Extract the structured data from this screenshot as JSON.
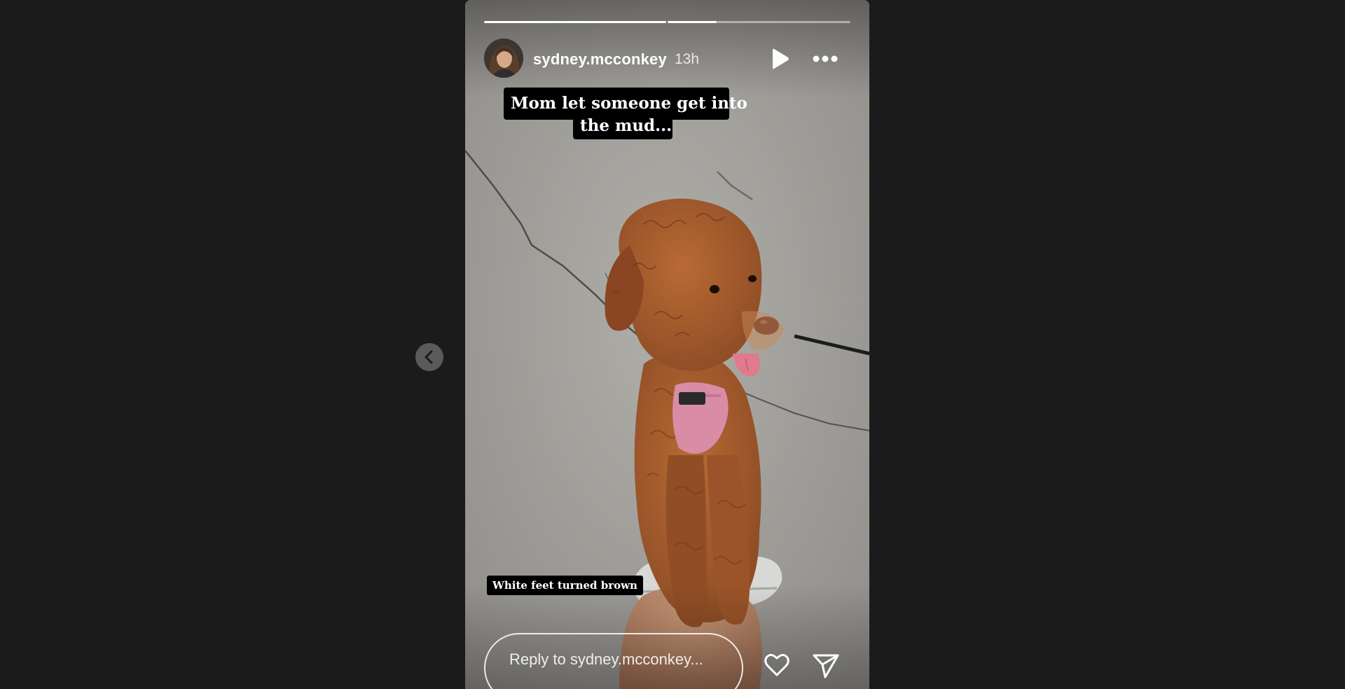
{
  "story": {
    "username": "sydney.mcconkey",
    "timestamp": "13h",
    "progress": [
      1.0,
      0.27
    ],
    "caption_lines": [
      "Mom let someone get into",
      "the mud..."
    ],
    "sticker_text": "White feet turned brown",
    "reply_placeholder": "Reply to sydney.mcconkey...",
    "icons": {
      "play": "play-icon",
      "more": "more-options-icon",
      "like": "heart-icon",
      "share": "send-icon",
      "prev": "chevron-left-icon"
    }
  },
  "colors": {
    "page_background": "#1b1b1b",
    "harness": "#d98ca6",
    "fur": "#a0582c",
    "pavement": "#9a9894"
  }
}
